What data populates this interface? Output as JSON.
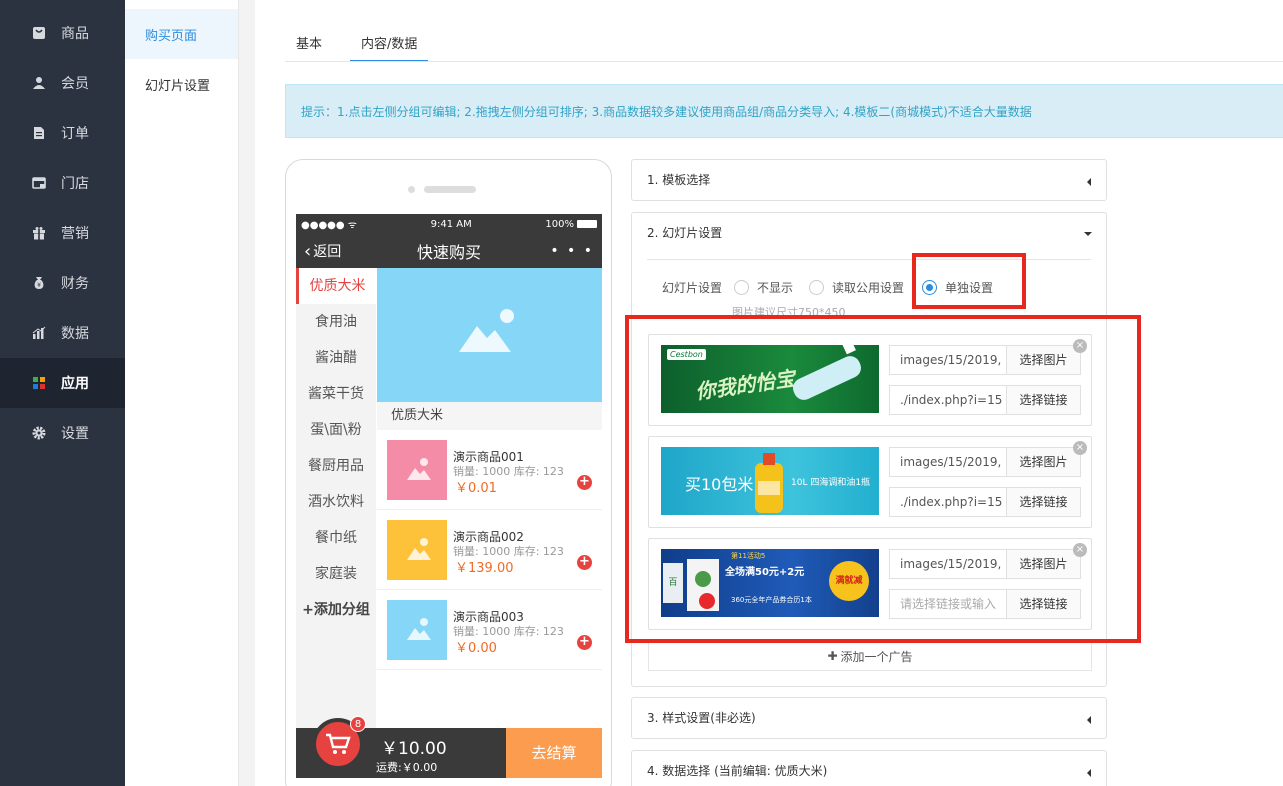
{
  "nav": {
    "items": [
      {
        "label": "商品",
        "icon": "bag-icon"
      },
      {
        "label": "会员",
        "icon": "user-icon"
      },
      {
        "label": "订单",
        "icon": "document-icon"
      },
      {
        "label": "门店",
        "icon": "store-icon"
      },
      {
        "label": "营销",
        "icon": "gift-icon"
      },
      {
        "label": "财务",
        "icon": "money-bag-icon"
      },
      {
        "label": "数据",
        "icon": "chart-icon"
      },
      {
        "label": "应用",
        "icon": "apps-icon"
      },
      {
        "label": "设置",
        "icon": "gear-icon"
      }
    ],
    "active": "应用"
  },
  "subnav": {
    "items": [
      {
        "label": "购买页面"
      },
      {
        "label": "幻灯片设置"
      }
    ]
  },
  "tabs": [
    {
      "label": "基本"
    },
    {
      "label": "内容/数据"
    }
  ],
  "tip": "提示：1.点击左侧分组可编辑; 2.拖拽左侧分组可排序; 3.商品数据较多建议使用商品组/商品分类导入; 4.模板二(商城模式)不适合大量数据",
  "phone": {
    "status": {
      "signal": "●●●●● ᯤ",
      "time": "9:41 AM",
      "battery": "100%"
    },
    "back": "返回",
    "title": "快速购买",
    "more": "• • •",
    "categories": [
      "优质大米",
      "食用油",
      "酱油醋",
      "酱菜干货",
      "蛋\\面\\粉",
      "餐厨用品",
      "酒水饮料",
      "餐巾纸",
      "家庭装"
    ],
    "add_category": "+添加分组",
    "section_title": "优质大米",
    "products": [
      {
        "name": "演示商品001",
        "meta": "销量: 1000 库存: 123",
        "price": "￥0.01",
        "color": "#f48ca8"
      },
      {
        "name": "演示商品002",
        "meta": "销量: 1000 库存: 123",
        "price": "￥139.00",
        "color": "#fec23a"
      },
      {
        "name": "演示商品003",
        "meta": "销量: 1000 库存: 123",
        "price": "￥0.00",
        "color": "#86d6f8"
      }
    ],
    "cart": {
      "badge": "8",
      "total": "￥10.00",
      "shipping": "运费:￥0.00",
      "checkout": "去结算"
    }
  },
  "panels": {
    "p1": {
      "title": "1. 模板选择"
    },
    "p2": {
      "title": "2. 幻灯片设置",
      "radio_label": "幻灯片设置",
      "options": [
        "不显示",
        "读取公用设置",
        "单独设置"
      ],
      "selected": "单独设置",
      "size_hint": "图片建议尺寸750*450",
      "slides": [
        {
          "image": "images/15/2019,",
          "link": "./index.php?i=15",
          "link_placeholder": ""
        },
        {
          "image": "images/15/2019,",
          "link": "./index.php?i=15",
          "link_placeholder": ""
        },
        {
          "image": "images/15/2019,",
          "link": "",
          "link_placeholder": "请选择链接或输入"
        }
      ],
      "choose_image": "选择图片",
      "choose_link": "选择链接",
      "add_ad": "添加一个广告",
      "banners": {
        "b1": {
          "brand": "Cestbon",
          "text": "你我的怡宝"
        },
        "b2": {
          "text": "买10包米",
          "sub": "10L 四海调和油1瓶"
        },
        "b3": {
          "badge": "第11活动5",
          "line1": "全场满50元+2元",
          "line2": "360元全年产品券合历1本",
          "stamp": "满就减",
          "side": "百"
        }
      }
    },
    "p3": {
      "title": "3. 样式设置(非必选)"
    },
    "p4": {
      "title": "4. 数据选择 (当前编辑: 优质大米)"
    }
  },
  "colors": {
    "accent": "#2c8de0",
    "nav_bg": "#2b3340",
    "highlight": "#e7281f",
    "price": "#ee6b28"
  }
}
